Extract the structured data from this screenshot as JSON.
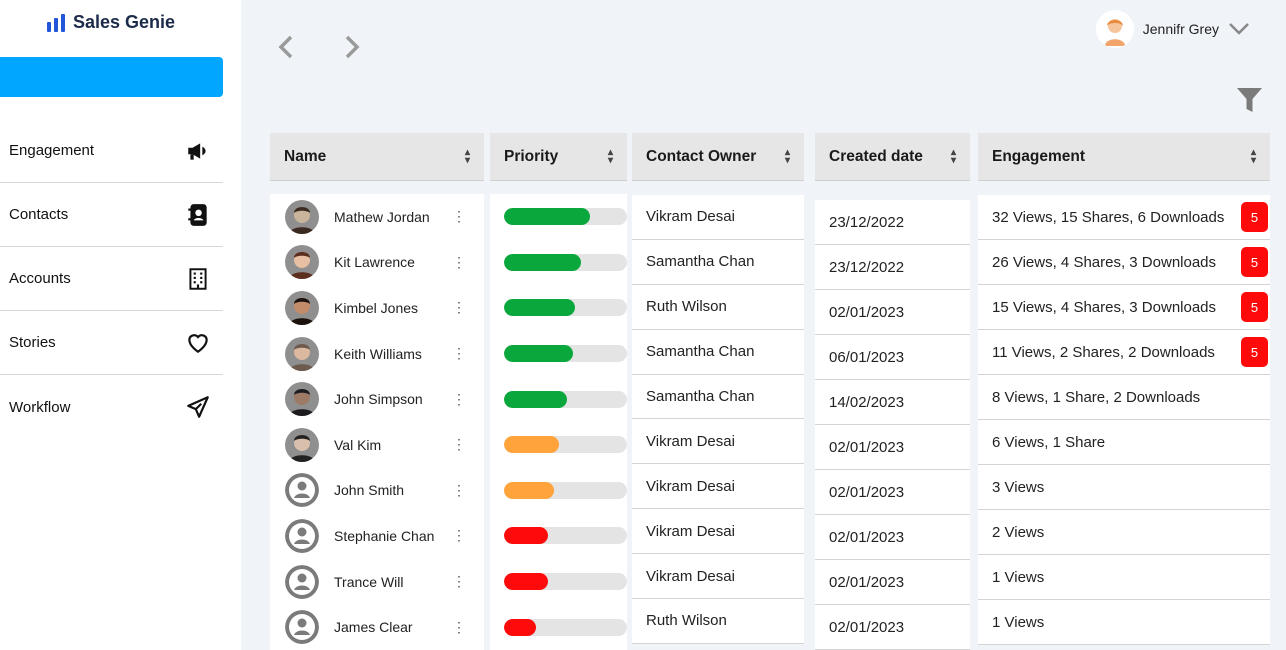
{
  "app": {
    "name": "Sales Genie"
  },
  "sidebar": {
    "items": [
      {
        "label": "Engagement",
        "icon": "megaphone-icon"
      },
      {
        "label": "Contacts",
        "icon": "contact-book-icon"
      },
      {
        "label": "Accounts",
        "icon": "building-icon"
      },
      {
        "label": "Stories",
        "icon": "heart-icon"
      },
      {
        "label": "Workflow",
        "icon": "paper-plane-icon"
      }
    ]
  },
  "header": {
    "user_name": "Jennifr Grey"
  },
  "table": {
    "columns": [
      "Name",
      "Priority",
      "Contact Owner",
      "Created date",
      "Engagement"
    ],
    "rows": [
      {
        "name": "Mathew Jordan",
        "priority": 0.7,
        "priority_color": "#0aa83c",
        "owner": "Vikram Desai",
        "date": "23/12/2022",
        "engagement": "32 Views, 15 Shares, 6 Downloads",
        "badge": "5",
        "avatar": "photo"
      },
      {
        "name": "Kit Lawrence",
        "priority": 0.63,
        "priority_color": "#0aa83c",
        "owner": "Samantha Chan",
        "date": "23/12/2022",
        "engagement": "26 Views, 4 Shares, 3 Downloads",
        "badge": "5",
        "avatar": "photo"
      },
      {
        "name": "Kimbel Jones",
        "priority": 0.58,
        "priority_color": "#0aa83c",
        "owner": "Ruth Wilson",
        "date": "02/01/2023",
        "engagement": "15 Views, 4 Shares, 3 Downloads",
        "badge": "5",
        "avatar": "photo"
      },
      {
        "name": "Keith Williams",
        "priority": 0.56,
        "priority_color": "#0aa83c",
        "owner": "Samantha Chan",
        "date": "06/01/2023",
        "engagement": "11 Views, 2 Shares, 2 Downloads",
        "badge": "5",
        "avatar": "photo"
      },
      {
        "name": "John Simpson",
        "priority": 0.51,
        "priority_color": "#0aa83c",
        "owner": "Samantha Chan",
        "date": "14/02/2023",
        "engagement": "8 Views, 1 Share, 2 Downloads",
        "badge": "",
        "avatar": "photo"
      },
      {
        "name": "Val Kim",
        "priority": 0.45,
        "priority_color": "#ffa33a",
        "owner": "Vikram Desai",
        "date": "02/01/2023",
        "engagement": "6 Views, 1 Share",
        "badge": "",
        "avatar": "photo"
      },
      {
        "name": "John Smith",
        "priority": 0.41,
        "priority_color": "#ffa33a",
        "owner": "Vikram Desai",
        "date": "02/01/2023",
        "engagement": "3 Views",
        "badge": "",
        "avatar": "placeholder"
      },
      {
        "name": "Stephanie Chan",
        "priority": 0.36,
        "priority_color": "#ff0a0a",
        "owner": "Vikram Desai",
        "date": "02/01/2023",
        "engagement": "2 Views",
        "badge": "",
        "avatar": "placeholder"
      },
      {
        "name": "Trance Will",
        "priority": 0.36,
        "priority_color": "#ff0a0a",
        "owner": "Vikram Desai",
        "date": "02/01/2023",
        "engagement": "1 Views",
        "badge": "",
        "avatar": "placeholder"
      },
      {
        "name": "James Clear",
        "priority": 0.26,
        "priority_color": "#ff0a0a",
        "owner": "Ruth Wilson",
        "date": "02/01/2023",
        "engagement": "1 Views",
        "badge": "",
        "avatar": "placeholder"
      }
    ]
  },
  "colors": {
    "accent": "#00a6ff",
    "brand": "#2255d8",
    "badge": "#ff0a0a"
  }
}
